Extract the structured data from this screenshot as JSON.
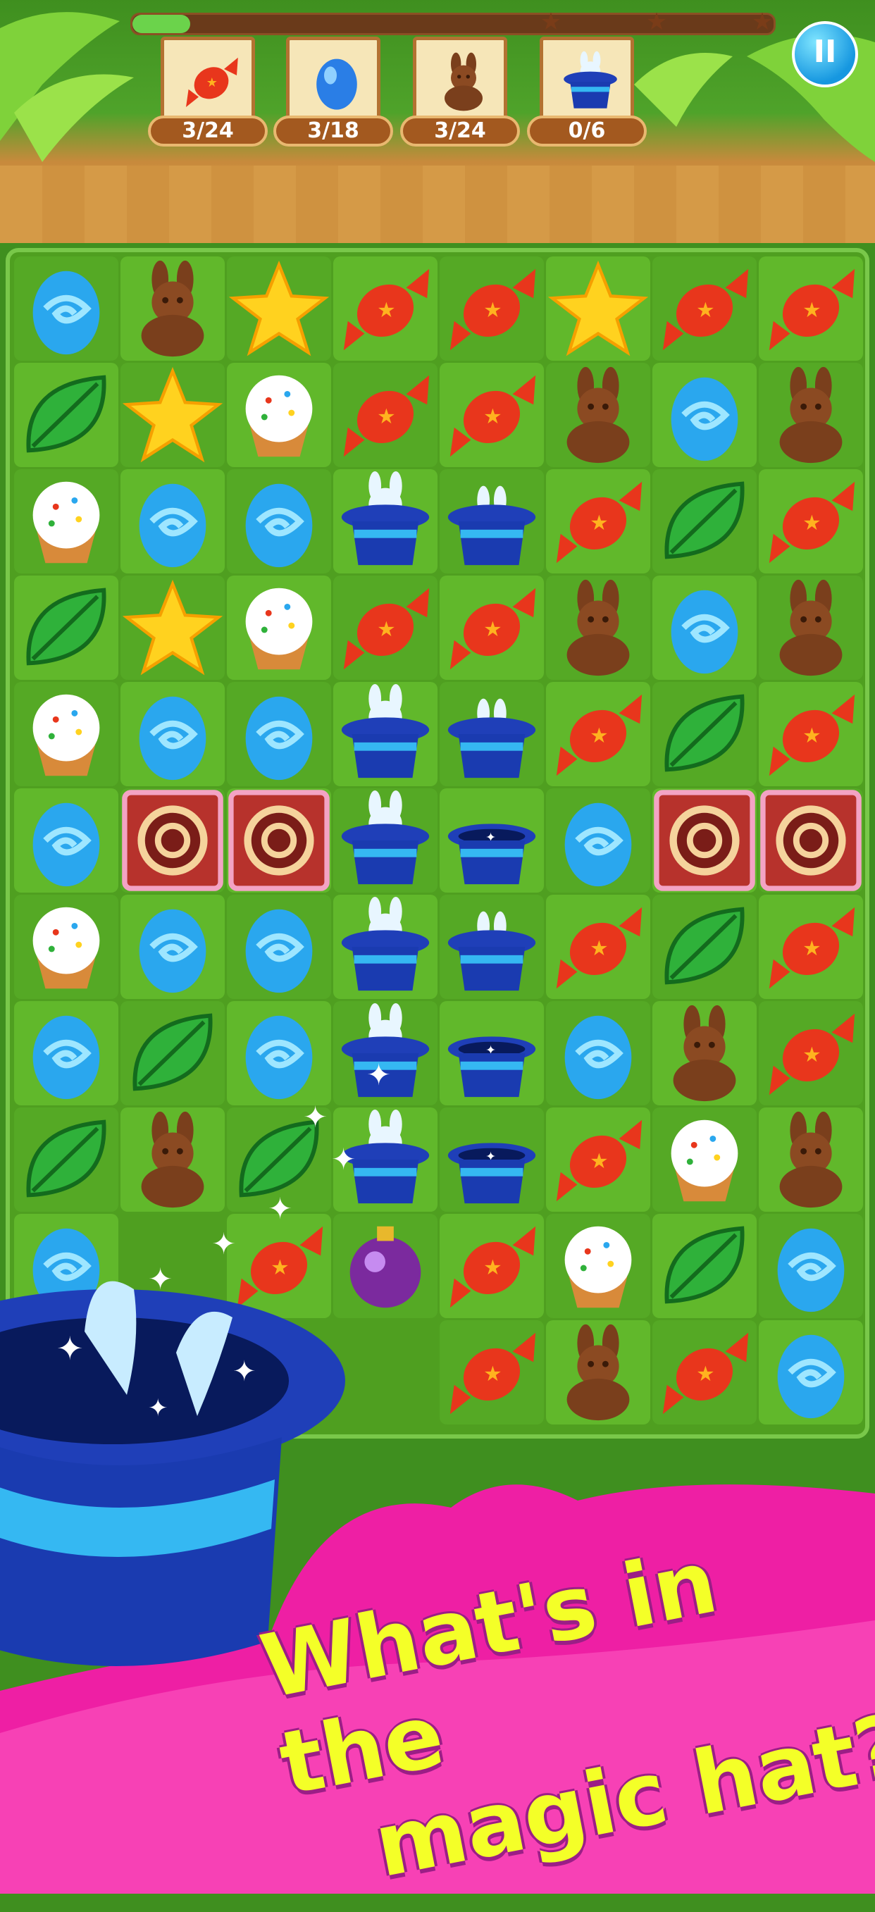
{
  "colors": {
    "accent": "#1697e0",
    "board": "#4f9f20",
    "promo_pink": "#ee1fa4",
    "headline": "#f4ff28"
  },
  "hud": {
    "progress_fraction": 0.09,
    "pause_icon": "pause-icon",
    "goals": [
      {
        "icon": "candy-icon",
        "count": "3/24"
      },
      {
        "icon": "blue-egg-icon",
        "count": "3/18"
      },
      {
        "icon": "chocolate-bunny-icon",
        "count": "3/24"
      },
      {
        "icon": "bunny-icon",
        "count": "0/6"
      }
    ]
  },
  "board": {
    "rows": [
      [
        "egg",
        "bunny",
        "star",
        "candy",
        "candy",
        "star",
        "candy",
        "candy"
      ],
      [
        "leaf",
        "star",
        "cupcake",
        "candy",
        "candy",
        "bunny",
        "egg",
        "bunny"
      ],
      [
        "cupcake",
        "egg",
        "egg",
        "hat-bunny",
        "hat-ears",
        "candy",
        "leaf",
        "candy"
      ],
      [
        "leaf",
        "star",
        "cupcake",
        "candy",
        "candy",
        "bunny",
        "egg",
        "bunny"
      ],
      [
        "cupcake",
        "egg",
        "egg",
        "hat-bunny",
        "hat-ears",
        "candy",
        "leaf",
        "candy"
      ],
      [
        "egg",
        "cake",
        "cake",
        "hat-bunny",
        "hat-sparkle",
        "egg",
        "cake",
        "cake"
      ],
      [
        "cupcake",
        "egg",
        "egg",
        "hat-bunny",
        "hat-ears",
        "candy",
        "leaf",
        "candy"
      ],
      [
        "egg",
        "leaf",
        "egg",
        "hat-bunny",
        "hat-sparkle",
        "egg",
        "bunny",
        "candy"
      ],
      [
        "leaf",
        "bunny",
        "leaf",
        "hat-bunny",
        "hat-sparkle",
        "candy",
        "cupcake",
        "bunny"
      ],
      [
        "egg",
        "empty",
        "candy",
        "bomb",
        "candy",
        "cupcake",
        "leaf",
        "egg"
      ],
      [
        "empty",
        "empty",
        "empty",
        "empty",
        "candy",
        "bunny",
        "candy",
        "egg"
      ]
    ]
  },
  "promo": {
    "line1": "What's in the",
    "line2": "magic hat?",
    "hat_icon": "magic-hat-icon"
  }
}
